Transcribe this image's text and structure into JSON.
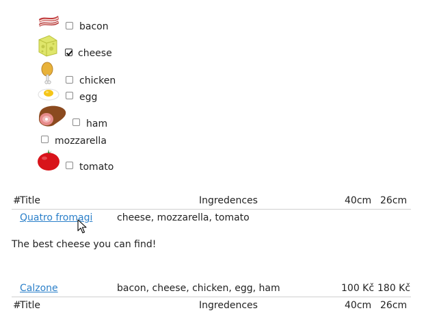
{
  "ingredients": [
    {
      "label": "bacon",
      "checked": false,
      "icon": "bacon-icon"
    },
    {
      "label": "cheese",
      "checked": true,
      "icon": "cheese-icon"
    },
    {
      "label": "chicken",
      "checked": false,
      "icon": "chicken-drumstick-icon"
    },
    {
      "label": "egg",
      "checked": false,
      "icon": "fried-egg-icon"
    },
    {
      "label": "ham",
      "checked": false,
      "icon": "ham-icon"
    },
    {
      "label": "mozzarella",
      "checked": false,
      "icon": ""
    },
    {
      "label": "tomato",
      "checked": false,
      "icon": "tomato-icon"
    }
  ],
  "table": {
    "headers": {
      "hash": "#",
      "title": "Title",
      "ingredients": "Ingredences",
      "size40": "40cm",
      "size26": "26cm"
    },
    "rows": [
      {
        "title": "Quatro fromagi",
        "ingredients": "cheese, mozzarella, tomato",
        "price40": "",
        "price26": "",
        "description": "The best cheese you can find!"
      },
      {
        "title": "Calzone",
        "ingredients": "bacon, cheese, chicken, egg, ham",
        "price40": "100 Kč",
        "price26": "180 Kč",
        "description": ""
      }
    ]
  }
}
